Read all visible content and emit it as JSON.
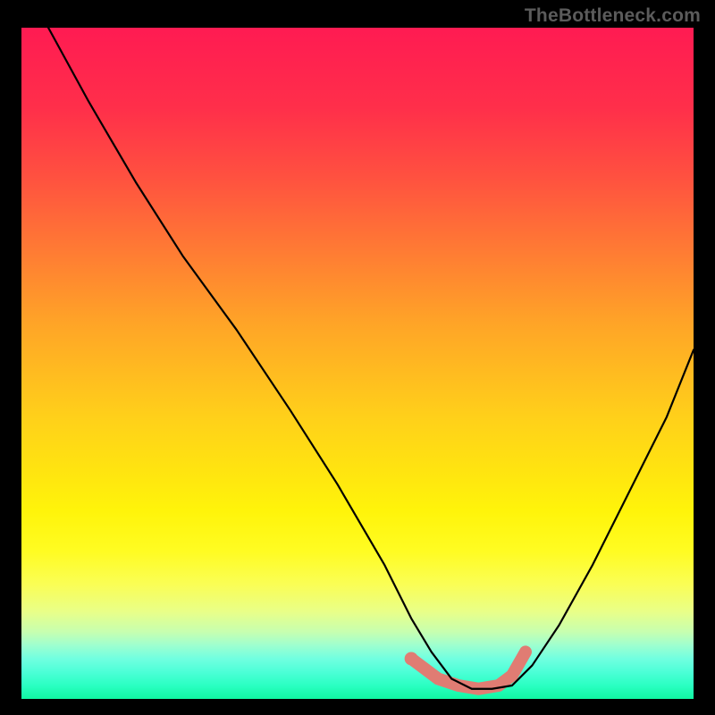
{
  "attribution": "TheBottleneck.com",
  "colors": {
    "frame": "#000000",
    "curve": "#000000",
    "marker": "#e07c73",
    "gradient_top": "#ff1b52",
    "gradient_mid": "#ffe410",
    "gradient_bottom": "#11f7a2"
  },
  "chart_data": {
    "type": "line",
    "title": "",
    "xlabel": "",
    "ylabel": "",
    "xlim": [
      0,
      100
    ],
    "ylim": [
      0,
      100
    ],
    "note": "No axis ticks or labels present; curve renders a V-shaped bottleneck profile with minimum near x≈65–70. Values are pixel-proportional estimates.",
    "series": [
      {
        "name": "curve",
        "x": [
          4,
          10,
          17,
          24,
          32,
          40,
          47,
          54,
          58,
          61,
          64,
          67,
          70,
          73,
          76,
          80,
          85,
          90,
          96,
          100
        ],
        "y": [
          100,
          89,
          77,
          66,
          55,
          43,
          32,
          20,
          12,
          7,
          3,
          1.5,
          1.5,
          2,
          5,
          11,
          20,
          30,
          42,
          52
        ]
      }
    ],
    "markers": {
      "name": "highlight-segment",
      "color": "#e07c73",
      "x": [
        58,
        62,
        65,
        68,
        71,
        73,
        75
      ],
      "y": [
        6,
        3,
        2,
        1.5,
        2,
        3.5,
        7
      ]
    }
  }
}
